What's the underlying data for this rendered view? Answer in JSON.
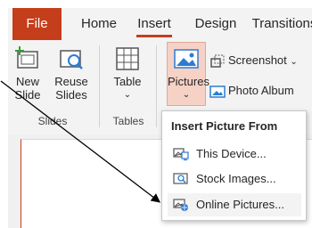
{
  "ribbon": {
    "tabs": [
      {
        "label": "File"
      },
      {
        "label": "Home"
      },
      {
        "label": "Insert"
      },
      {
        "label": "Design"
      },
      {
        "label": "Transitions"
      }
    ],
    "buttons": {
      "new_slide": "New Slide",
      "reuse_slides": "Reuse Slides",
      "table": "Table",
      "pictures": "Pictures",
      "screenshot": "Screenshot",
      "photo_album": "Photo Album"
    },
    "groups": {
      "slides": "Slides",
      "tables": "Tables"
    }
  },
  "dropdown": {
    "header": "Insert Picture From",
    "items": [
      {
        "label": "This Device..."
      },
      {
        "label": "Stock Images..."
      },
      {
        "label": "Online Pictures..."
      }
    ]
  },
  "colors": {
    "accent": "#c43e1c",
    "pictures_highlight": "#f6d1c6"
  }
}
